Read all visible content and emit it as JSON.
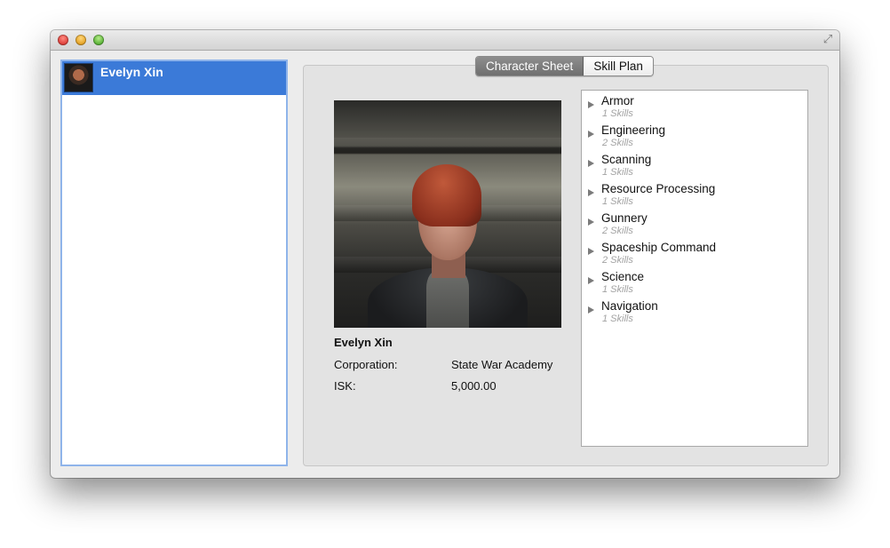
{
  "window": {
    "title": ""
  },
  "sidebar": {
    "characters": [
      {
        "name": "Evelyn Xin",
        "selected": true
      }
    ]
  },
  "tabs": [
    {
      "label": "Character Sheet",
      "active": true
    },
    {
      "label": "Skill Plan",
      "active": false
    }
  ],
  "character": {
    "name": "Evelyn Xin",
    "corporation_label": "Corporation:",
    "corporation": "State War Academy",
    "isk_label": "ISK:",
    "isk": "5,000.00"
  },
  "skills": [
    {
      "name": "Armor",
      "count": "1 Skills"
    },
    {
      "name": "Engineering",
      "count": "2 Skills"
    },
    {
      "name": "Scanning",
      "count": "1 Skills"
    },
    {
      "name": "Resource Processing",
      "count": "1 Skills"
    },
    {
      "name": "Gunnery",
      "count": "2 Skills"
    },
    {
      "name": "Spaceship Command",
      "count": "2 Skills"
    },
    {
      "name": "Science",
      "count": "1 Skills"
    },
    {
      "name": "Navigation",
      "count": "1 Skills"
    }
  ],
  "colors": {
    "selection": "#3b7ad8",
    "panel": "#e3e3e3",
    "muted_text": "#a2a2a2"
  },
  "icons": {
    "close": "close-icon",
    "minimize": "minimize-icon",
    "zoom": "zoom-icon",
    "fullscreen": "fullscreen-icon",
    "disclosure": "disclosure-triangle-icon"
  }
}
